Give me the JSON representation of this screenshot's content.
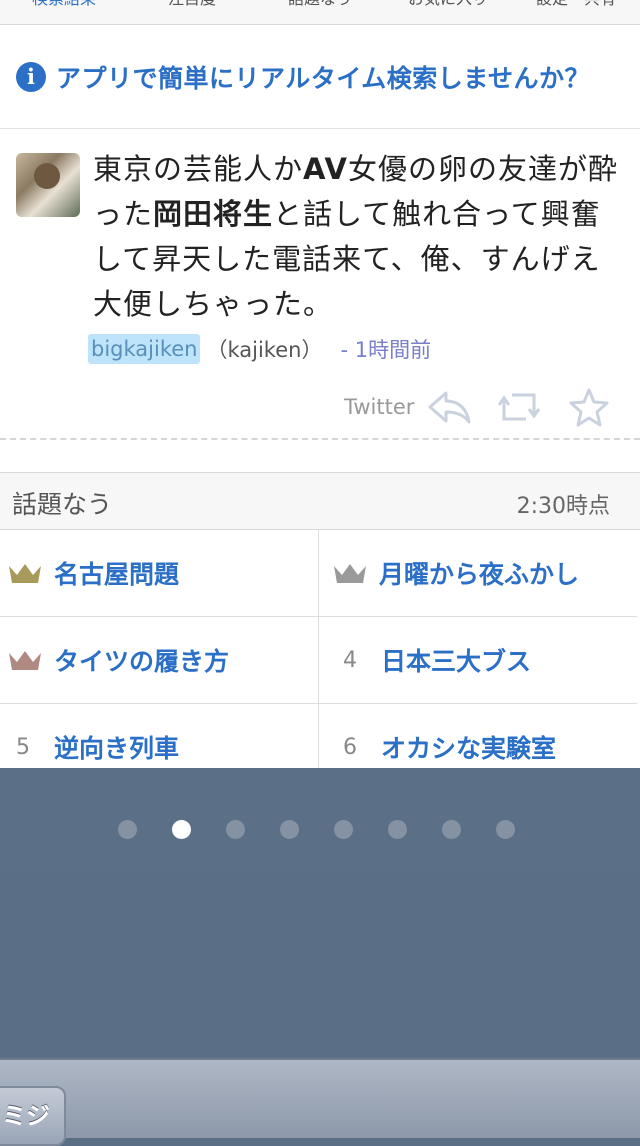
{
  "tabs": [
    {
      "label": "検索結果",
      "active": true
    },
    {
      "label": "注目度"
    },
    {
      "label": "話題なう"
    },
    {
      "label": "お気に入り"
    },
    {
      "label": "設定・共有"
    }
  ],
  "promo": {
    "icon": "info-icon",
    "text": "アプリで簡単にリアルタイム検索しませんか？"
  },
  "tweet": {
    "segments": [
      {
        "text": "東京の芸能人か"
      },
      {
        "text": "AV",
        "bold": true
      },
      {
        "text": "女優の卵の友達が酔った"
      },
      {
        "text": "岡田将生",
        "bold": true
      },
      {
        "text": "と話して触れ合って興奮して昇天した電話来て、俺、すんげえ大便しちゃった。"
      }
    ],
    "user": "bigkajiken",
    "handle": "（kajiken）",
    "time": "- 1時間前",
    "source": "Twitter",
    "actions": [
      "reply-icon",
      "retweet-icon",
      "favorite-star-icon"
    ]
  },
  "trending": {
    "title": "話題なう",
    "time": "2:30時点",
    "items": [
      {
        "rank": "1",
        "label": "名古屋問題",
        "crown": "gold-crown-icon",
        "color": "#a89a5a"
      },
      {
        "rank": "2",
        "label": "月曜から夜ふかし",
        "crown": "silver-crown-icon",
        "color": "#9a9a9a"
      },
      {
        "rank": "3",
        "label": "タイツの履き方",
        "crown": "bronze-crown-icon",
        "color": "#b08a82"
      },
      {
        "rank": "4",
        "label": "日本三大ブス"
      },
      {
        "rank": "5",
        "label": "逆向き列車"
      },
      {
        "rank": "6",
        "label": "オカシな実験室"
      }
    ]
  },
  "pager": {
    "count": 8,
    "active_index": 1
  },
  "dock": {
    "button_label": "ミジ"
  },
  "colors": {
    "accent": "#2b6fc6",
    "background": "#5a6e85"
  }
}
